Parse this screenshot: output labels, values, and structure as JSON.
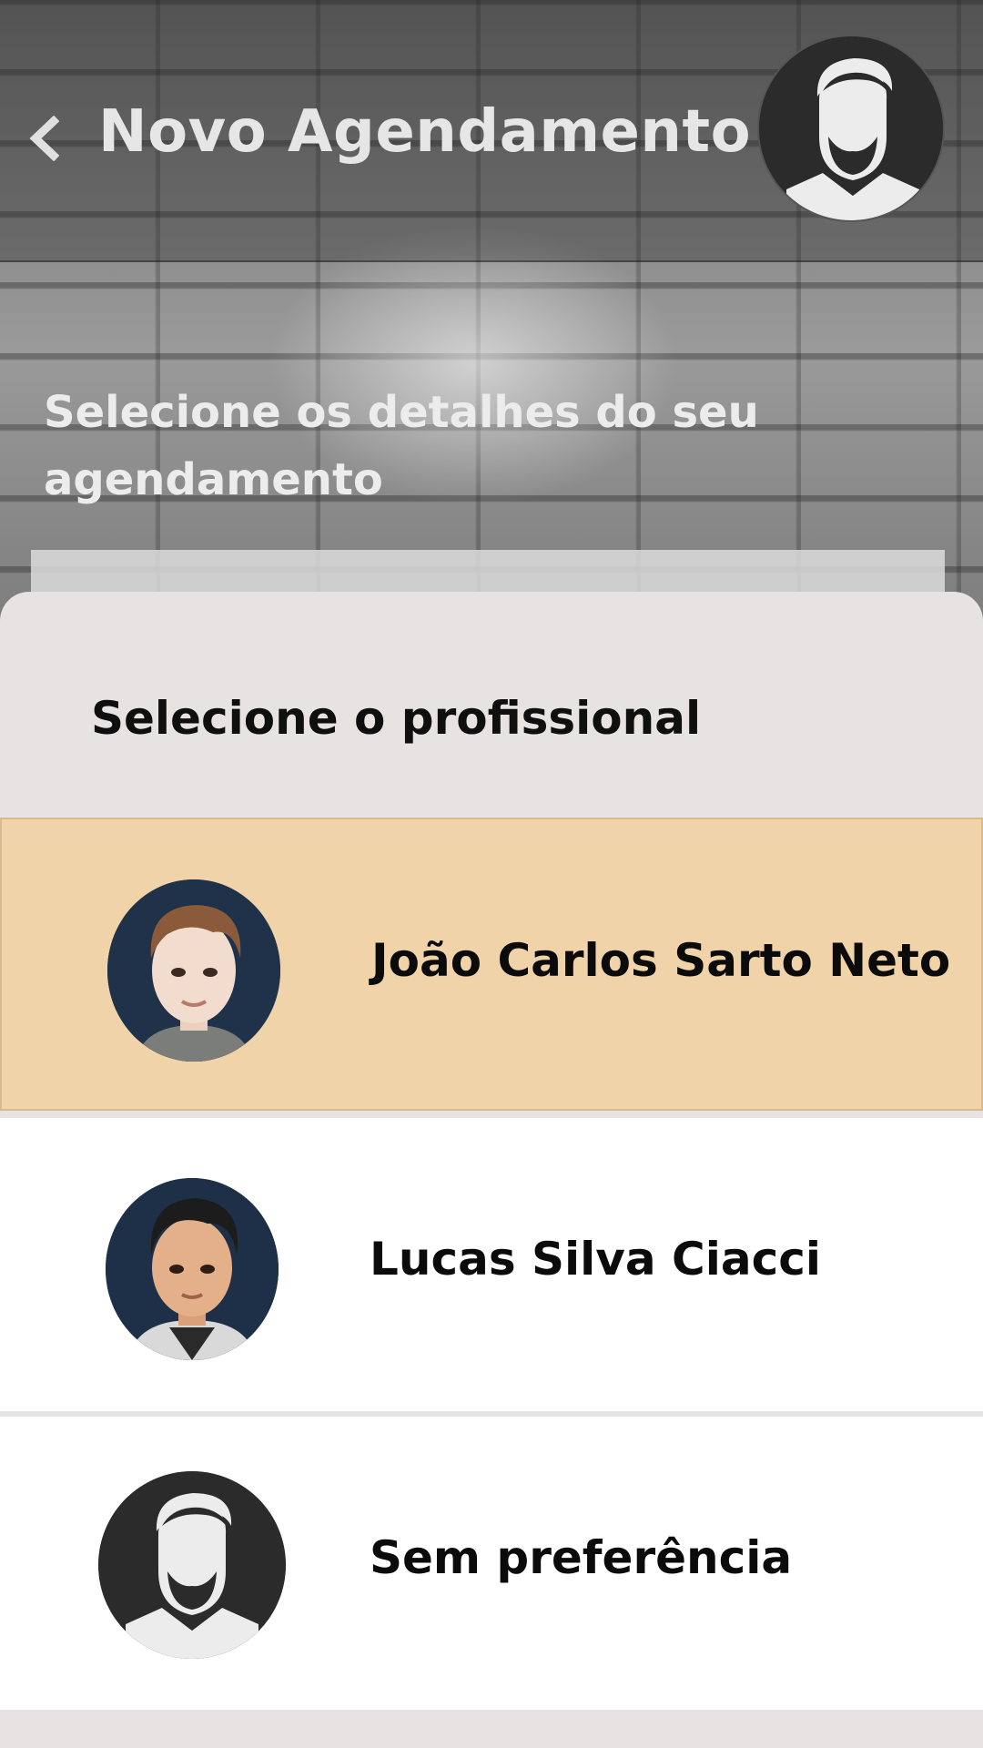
{
  "header": {
    "title": "Novo Agendamento",
    "back_icon": "chevron-left-icon",
    "profile_icon": "barber-avatar-icon"
  },
  "subtitle": "Selecione os detalhes do seu agendamento",
  "sheet": {
    "title": "Selecione o profissional",
    "professionals": [
      {
        "name": "João Carlos Sarto Neto",
        "selected": true,
        "avatar": "avatar-3d-man-brown-hair"
      },
      {
        "name": "Lucas Silva Ciacci",
        "selected": false,
        "avatar": "avatar-3d-man-black-hair"
      },
      {
        "name": "Sem preferência",
        "selected": false,
        "avatar": "barber-avatar-icon"
      }
    ]
  },
  "colors": {
    "selected_bg": "#f1d3a9",
    "sheet_bg": "#e7e3e2",
    "item_bg": "#ffffff",
    "text_dark": "#0b0b0b",
    "header_text": "#e6e6e6"
  }
}
